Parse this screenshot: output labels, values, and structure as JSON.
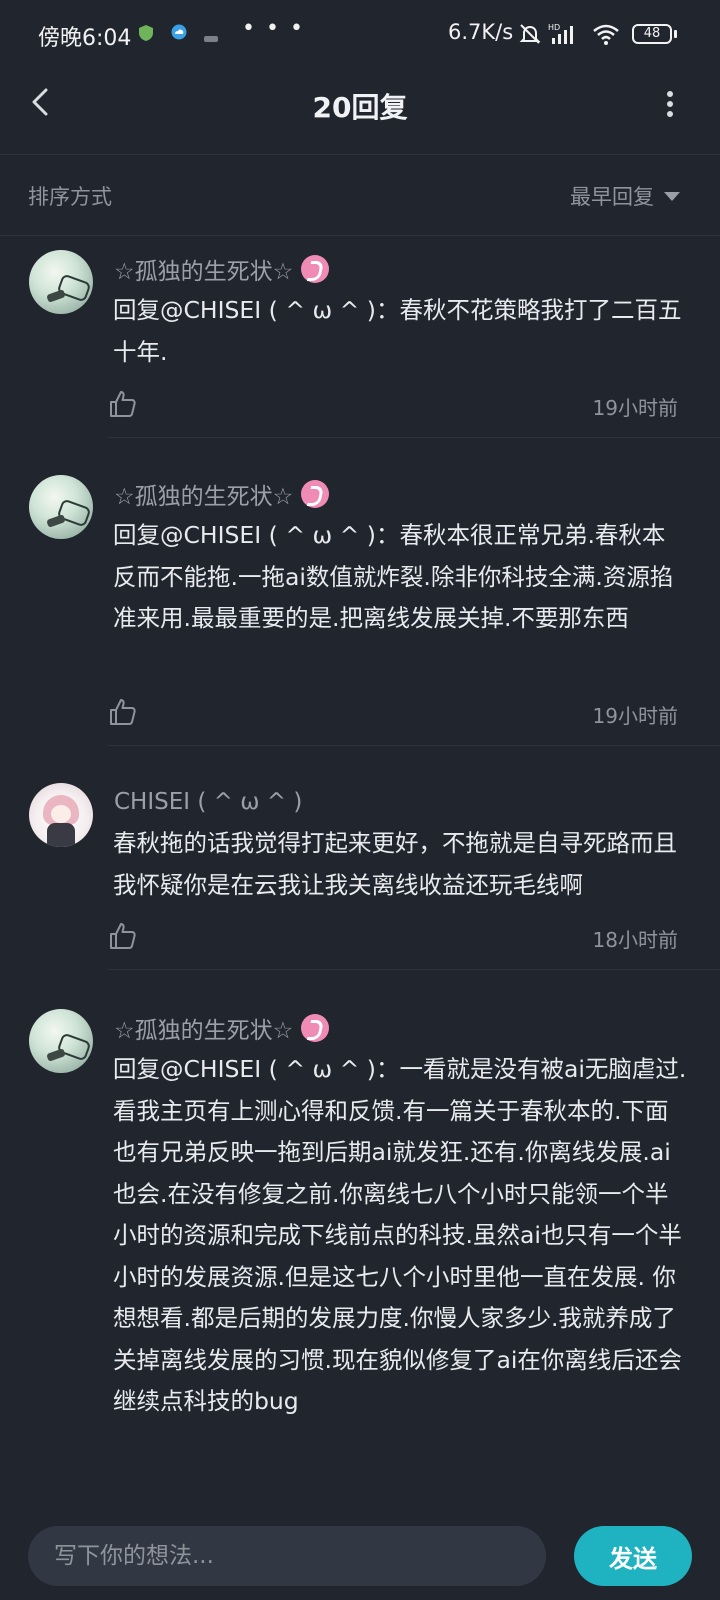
{
  "status_bar": {
    "time": "傍晚6:04",
    "more": "• • •",
    "net_speed": "6.7K/s",
    "battery": "48"
  },
  "header": {
    "title": "20回复"
  },
  "sort": {
    "label": "排序方式",
    "selected": "最早回复"
  },
  "comments": [
    {
      "username": "☆孤独的生死状☆",
      "text": "回复@CHISEI ( ^ ω ^ )：春秋不花策略我打了二百五十年.",
      "time": "19小时前"
    },
    {
      "username": "☆孤独的生死状☆",
      "text": "回复@CHISEI ( ^ ω ^ )：春秋本很正常兄弟.春秋本反而不能拖.一拖ai数值就炸裂.除非你科技全满.资源掐准来用.最最重要的是.把离线发展关掉.不要那东西",
      "time": "19小时前"
    },
    {
      "username": "CHISEI ( ^ ω ^ )",
      "text": "春秋拖的话我觉得打起来更好，不拖就是自寻死路而且我怀疑你是在云我让我关离线收益还玩毛线啊",
      "time": "18小时前"
    },
    {
      "username": "☆孤独的生死状☆",
      "text": "回复@CHISEI ( ^ ω ^ )：一看就是没有被ai无脑虐过.看我主页有上测心得和反馈.有一篇关于春秋本的.下面也有兄弟反映一拖到后期ai就发狂.还有.你离线发展.ai也会.在没有修复之前.你离线七八个小时只能领一个半小时的资源和完成下线前点的科技.虽然ai也只有一个半小时的发展资源.但是这七八个小时里他一直在发展. 你想想看.都是后期的发展力度.你慢人家多少.我就养成了关掉离线发展的习惯.现在貌似修复了ai在你离线后还会继续点科技的bug"
    }
  ],
  "composer": {
    "placeholder": "写下你的想法...",
    "send_label": "发送"
  }
}
